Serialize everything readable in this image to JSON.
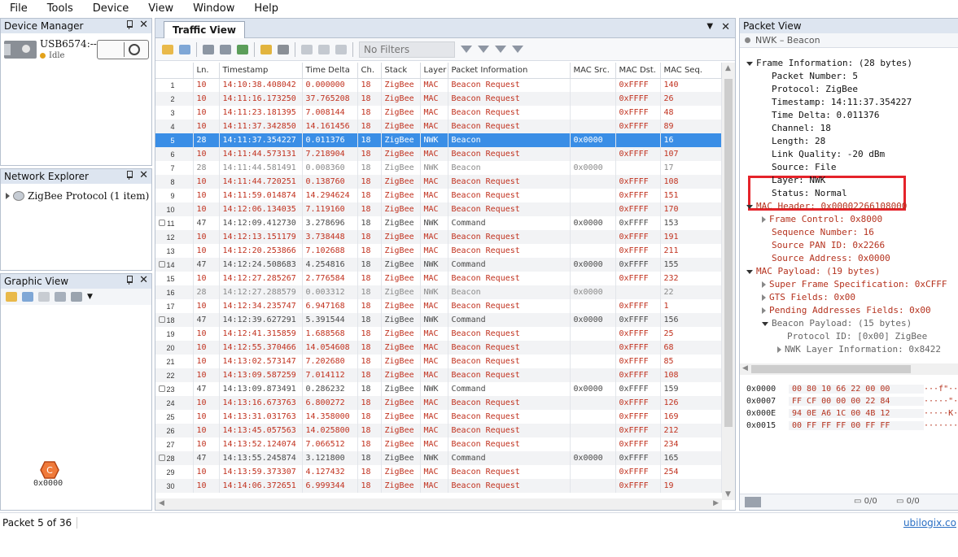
{
  "menu": [
    "File",
    "Tools",
    "Device",
    "View",
    "Window",
    "Help"
  ],
  "device_manager": {
    "title": "Device Manager",
    "device_name": "USB6574:---",
    "device_status": "Idle"
  },
  "network_explorer": {
    "title": "Network Explorer",
    "item": "ZigBee Protocol (1 item)"
  },
  "graphic_view": {
    "title": "Graphic View",
    "node_letter": "C",
    "node_label": "0x0000"
  },
  "traffic_view": {
    "tab": "Traffic View",
    "filter_placeholder": "No Filters",
    "columns": [
      "",
      "Ln.",
      "Timestamp",
      "Time Delta",
      "Ch.",
      "Stack",
      "Layer",
      "Packet Information",
      "MAC Src.",
      "MAC Dst.",
      "MAC Seq."
    ],
    "rows": [
      {
        "n": "1",
        "ln": "10",
        "ts": "14:10:38.408042",
        "td": "0.000000",
        "ch": "18",
        "stack": "ZigBee",
        "layer": "MAC",
        "info": "Beacon Request",
        "src": "",
        "dst": "0xFFFF",
        "seq": "140",
        "kind": "req",
        "mark": false
      },
      {
        "n": "2",
        "ln": "10",
        "ts": "14:11:16.173250",
        "td": "37.765208",
        "ch": "18",
        "stack": "ZigBee",
        "layer": "MAC",
        "info": "Beacon Request",
        "src": "",
        "dst": "0xFFFF",
        "seq": "26",
        "kind": "req",
        "mark": false
      },
      {
        "n": "3",
        "ln": "10",
        "ts": "14:11:23.181395",
        "td": "7.008144",
        "ch": "18",
        "stack": "ZigBee",
        "layer": "MAC",
        "info": "Beacon Request",
        "src": "",
        "dst": "0xFFFF",
        "seq": "48",
        "kind": "req",
        "mark": false
      },
      {
        "n": "4",
        "ln": "10",
        "ts": "14:11:37.342850",
        "td": "14.161456",
        "ch": "18",
        "stack": "ZigBee",
        "layer": "MAC",
        "info": "Beacon Request",
        "src": "",
        "dst": "0xFFFF",
        "seq": "89",
        "kind": "req",
        "mark": false
      },
      {
        "n": "5",
        "ln": "28",
        "ts": "14:11:37.354227",
        "td": "0.011376",
        "ch": "18",
        "stack": "ZigBee",
        "layer": "NWK",
        "info": "Beacon",
        "src": "0x0000",
        "dst": "",
        "seq": "16",
        "kind": "sel",
        "mark": false
      },
      {
        "n": "6",
        "ln": "10",
        "ts": "14:11:44.573131",
        "td": "7.218904",
        "ch": "18",
        "stack": "ZigBee",
        "layer": "MAC",
        "info": "Beacon Request",
        "src": "",
        "dst": "0xFFFF",
        "seq": "107",
        "kind": "req",
        "mark": false
      },
      {
        "n": "7",
        "ln": "28",
        "ts": "14:11:44.581491",
        "td": "0.008360",
        "ch": "18",
        "stack": "ZigBee",
        "layer": "NWK",
        "info": "Beacon",
        "src": "0x0000",
        "dst": "",
        "seq": "17",
        "kind": "gray",
        "mark": false
      },
      {
        "n": "8",
        "ln": "10",
        "ts": "14:11:44.720251",
        "td": "0.138760",
        "ch": "18",
        "stack": "ZigBee",
        "layer": "MAC",
        "info": "Beacon Request",
        "src": "",
        "dst": "0xFFFF",
        "seq": "108",
        "kind": "req",
        "mark": false
      },
      {
        "n": "9",
        "ln": "10",
        "ts": "14:11:59.014874",
        "td": "14.294624",
        "ch": "18",
        "stack": "ZigBee",
        "layer": "MAC",
        "info": "Beacon Request",
        "src": "",
        "dst": "0xFFFF",
        "seq": "151",
        "kind": "req",
        "mark": false
      },
      {
        "n": "10",
        "ln": "10",
        "ts": "14:12:06.134035",
        "td": "7.119160",
        "ch": "18",
        "stack": "ZigBee",
        "layer": "MAC",
        "info": "Beacon Request",
        "src": "",
        "dst": "0xFFFF",
        "seq": "170",
        "kind": "req",
        "mark": false
      },
      {
        "n": "11",
        "ln": "47",
        "ts": "14:12:09.412730",
        "td": "3.278696",
        "ch": "18",
        "stack": "ZigBee",
        "layer": "NWK",
        "info": "Command",
        "src": "0x0000",
        "dst": "0xFFFF",
        "seq": "153",
        "kind": "cmd",
        "mark": true
      },
      {
        "n": "12",
        "ln": "10",
        "ts": "14:12:13.151179",
        "td": "3.738448",
        "ch": "18",
        "stack": "ZigBee",
        "layer": "MAC",
        "info": "Beacon Request",
        "src": "",
        "dst": "0xFFFF",
        "seq": "191",
        "kind": "req",
        "mark": false
      },
      {
        "n": "13",
        "ln": "10",
        "ts": "14:12:20.253866",
        "td": "7.102688",
        "ch": "18",
        "stack": "ZigBee",
        "layer": "MAC",
        "info": "Beacon Request",
        "src": "",
        "dst": "0xFFFF",
        "seq": "211",
        "kind": "req",
        "mark": false
      },
      {
        "n": "14",
        "ln": "47",
        "ts": "14:12:24.508683",
        "td": "4.254816",
        "ch": "18",
        "stack": "ZigBee",
        "layer": "NWK",
        "info": "Command",
        "src": "0x0000",
        "dst": "0xFFFF",
        "seq": "155",
        "kind": "cmd",
        "mark": true
      },
      {
        "n": "15",
        "ln": "10",
        "ts": "14:12:27.285267",
        "td": "2.776584",
        "ch": "18",
        "stack": "ZigBee",
        "layer": "MAC",
        "info": "Beacon Request",
        "src": "",
        "dst": "0xFFFF",
        "seq": "232",
        "kind": "req",
        "mark": false
      },
      {
        "n": "16",
        "ln": "28",
        "ts": "14:12:27.288579",
        "td": "0.003312",
        "ch": "18",
        "stack": "ZigBee",
        "layer": "NWK",
        "info": "Beacon",
        "src": "0x0000",
        "dst": "",
        "seq": "22",
        "kind": "gray",
        "mark": false
      },
      {
        "n": "17",
        "ln": "10",
        "ts": "14:12:34.235747",
        "td": "6.947168",
        "ch": "18",
        "stack": "ZigBee",
        "layer": "MAC",
        "info": "Beacon Request",
        "src": "",
        "dst": "0xFFFF",
        "seq": "1",
        "kind": "req",
        "mark": false
      },
      {
        "n": "18",
        "ln": "47",
        "ts": "14:12:39.627291",
        "td": "5.391544",
        "ch": "18",
        "stack": "ZigBee",
        "layer": "NWK",
        "info": "Command",
        "src": "0x0000",
        "dst": "0xFFFF",
        "seq": "156",
        "kind": "cmd",
        "mark": true
      },
      {
        "n": "19",
        "ln": "10",
        "ts": "14:12:41.315859",
        "td": "1.688568",
        "ch": "18",
        "stack": "ZigBee",
        "layer": "MAC",
        "info": "Beacon Request",
        "src": "",
        "dst": "0xFFFF",
        "seq": "25",
        "kind": "req",
        "mark": false
      },
      {
        "n": "20",
        "ln": "10",
        "ts": "14:12:55.370466",
        "td": "14.054608",
        "ch": "18",
        "stack": "ZigBee",
        "layer": "MAC",
        "info": "Beacon Request",
        "src": "",
        "dst": "0xFFFF",
        "seq": "68",
        "kind": "req",
        "mark": false
      },
      {
        "n": "21",
        "ln": "10",
        "ts": "14:13:02.573147",
        "td": "7.202680",
        "ch": "18",
        "stack": "ZigBee",
        "layer": "MAC",
        "info": "Beacon Request",
        "src": "",
        "dst": "0xFFFF",
        "seq": "85",
        "kind": "req",
        "mark": false
      },
      {
        "n": "22",
        "ln": "10",
        "ts": "14:13:09.587259",
        "td": "7.014112",
        "ch": "18",
        "stack": "ZigBee",
        "layer": "MAC",
        "info": "Beacon Request",
        "src": "",
        "dst": "0xFFFF",
        "seq": "108",
        "kind": "req",
        "mark": false
      },
      {
        "n": "23",
        "ln": "47",
        "ts": "14:13:09.873491",
        "td": "0.286232",
        "ch": "18",
        "stack": "ZigBee",
        "layer": "NWK",
        "info": "Command",
        "src": "0x0000",
        "dst": "0xFFFF",
        "seq": "159",
        "kind": "cmd",
        "mark": true
      },
      {
        "n": "24",
        "ln": "10",
        "ts": "14:13:16.673763",
        "td": "6.800272",
        "ch": "18",
        "stack": "ZigBee",
        "layer": "MAC",
        "info": "Beacon Request",
        "src": "",
        "dst": "0xFFFF",
        "seq": "126",
        "kind": "req",
        "mark": false
      },
      {
        "n": "25",
        "ln": "10",
        "ts": "14:13:31.031763",
        "td": "14.358000",
        "ch": "18",
        "stack": "ZigBee",
        "layer": "MAC",
        "info": "Beacon Request",
        "src": "",
        "dst": "0xFFFF",
        "seq": "169",
        "kind": "req",
        "mark": false
      },
      {
        "n": "26",
        "ln": "10",
        "ts": "14:13:45.057563",
        "td": "14.025800",
        "ch": "18",
        "stack": "ZigBee",
        "layer": "MAC",
        "info": "Beacon Request",
        "src": "",
        "dst": "0xFFFF",
        "seq": "212",
        "kind": "req",
        "mark": false
      },
      {
        "n": "27",
        "ln": "10",
        "ts": "14:13:52.124074",
        "td": "7.066512",
        "ch": "18",
        "stack": "ZigBee",
        "layer": "MAC",
        "info": "Beacon Request",
        "src": "",
        "dst": "0xFFFF",
        "seq": "234",
        "kind": "req",
        "mark": false
      },
      {
        "n": "28",
        "ln": "47",
        "ts": "14:13:55.245874",
        "td": "3.121800",
        "ch": "18",
        "stack": "ZigBee",
        "layer": "NWK",
        "info": "Command",
        "src": "0x0000",
        "dst": "0xFFFF",
        "seq": "165",
        "kind": "cmd",
        "mark": true
      },
      {
        "n": "29",
        "ln": "10",
        "ts": "14:13:59.373307",
        "td": "4.127432",
        "ch": "18",
        "stack": "ZigBee",
        "layer": "MAC",
        "info": "Beacon Request",
        "src": "",
        "dst": "0xFFFF",
        "seq": "254",
        "kind": "req",
        "mark": false
      },
      {
        "n": "30",
        "ln": "10",
        "ts": "14:14:06.372651",
        "td": "6.999344",
        "ch": "18",
        "stack": "ZigBee",
        "layer": "MAC",
        "info": "Beacon Request",
        "src": "",
        "dst": "0xFFFF",
        "seq": "19",
        "kind": "req",
        "mark": false
      }
    ]
  },
  "packet_view": {
    "title": "Packet View",
    "subtitle": "NWK – Beacon",
    "lines": [
      {
        "text": "Frame Information: (28 bytes)",
        "indent": 0,
        "marker": "down",
        "style": "normal"
      },
      {
        "text": "Packet Number: 5",
        "indent": 1,
        "marker": "",
        "style": "normal"
      },
      {
        "text": "Protocol: ZigBee",
        "indent": 1,
        "marker": "",
        "style": "normal"
      },
      {
        "text": "Timestamp: 14:11:37.354227",
        "indent": 1,
        "marker": "",
        "style": "normal"
      },
      {
        "text": "Time Delta: 0.011376",
        "indent": 1,
        "marker": "",
        "style": "normal"
      },
      {
        "text": "Channel: 18",
        "indent": 1,
        "marker": "",
        "style": "normal"
      },
      {
        "text": "Length: 28",
        "indent": 1,
        "marker": "",
        "style": "normal"
      },
      {
        "text": "Link Quality: -20 dBm",
        "indent": 1,
        "marker": "",
        "style": "normal"
      },
      {
        "text": "Source: File",
        "indent": 1,
        "marker": "",
        "style": "normal"
      },
      {
        "text": "Layer: NWK",
        "indent": 1,
        "marker": "",
        "style": "normal"
      },
      {
        "text": "Status: Normal",
        "indent": 1,
        "marker": "",
        "style": "normal"
      },
      {
        "text": "MAC Header: 0x00002266108000",
        "indent": 0,
        "marker": "down",
        "style": "blue"
      },
      {
        "text": "Frame Control: 0x8000",
        "indent": 1,
        "marker": "right",
        "style": "blue"
      },
      {
        "text": "Sequence Number: 16",
        "indent": 1,
        "marker": "",
        "style": "blue"
      },
      {
        "text": "Source PAN ID: 0x2266",
        "indent": 1,
        "marker": "",
        "style": "blue"
      },
      {
        "text": "Source Address: 0x0000",
        "indent": 1,
        "marker": "",
        "style": "blue"
      },
      {
        "text": "MAC Payload: (19 bytes)",
        "indent": 0,
        "marker": "down",
        "style": "blue"
      },
      {
        "text": "Super Frame Specification: 0xCFFF",
        "indent": 1,
        "marker": "right",
        "style": "blue"
      },
      {
        "text": "GTS Fields: 0x00",
        "indent": 1,
        "marker": "right",
        "style": "blue"
      },
      {
        "text": "Pending Addresses Fields: 0x00",
        "indent": 1,
        "marker": "right",
        "style": "blue"
      },
      {
        "text": "Beacon Payload: (15 bytes)",
        "indent": 1,
        "marker": "down",
        "style": "dim"
      },
      {
        "text": "Protocol ID: [0x00] ZigBee",
        "indent": 2,
        "marker": "",
        "style": "dim"
      },
      {
        "text": "NWK Layer Information: 0x8422",
        "indent": 2,
        "marker": "right",
        "style": "dim"
      }
    ],
    "hex": [
      {
        "off": "0x0000",
        "bytes": "00 80 10 66 22 00 00",
        "asc": "···f\"··"
      },
      {
        "off": "0x0007",
        "bytes": "FF CF 00 00 00 22 84",
        "asc": "·····\"·"
      },
      {
        "off": "0x000E",
        "bytes": "94 0E A6 1C 00 4B 12",
        "asc": "·····K·"
      },
      {
        "off": "0x0015",
        "bytes": "00 FF FF FF 00 FF FF",
        "asc": "·······"
      }
    ],
    "count_a": "0/0",
    "count_b": "0/0"
  },
  "status": {
    "text": "Packet 5 of 36",
    "link": "ubilogix.co"
  },
  "colors": {
    "accent": "#3a8ee6",
    "request_text": "#c1311e",
    "highlight": "#e5232a"
  }
}
